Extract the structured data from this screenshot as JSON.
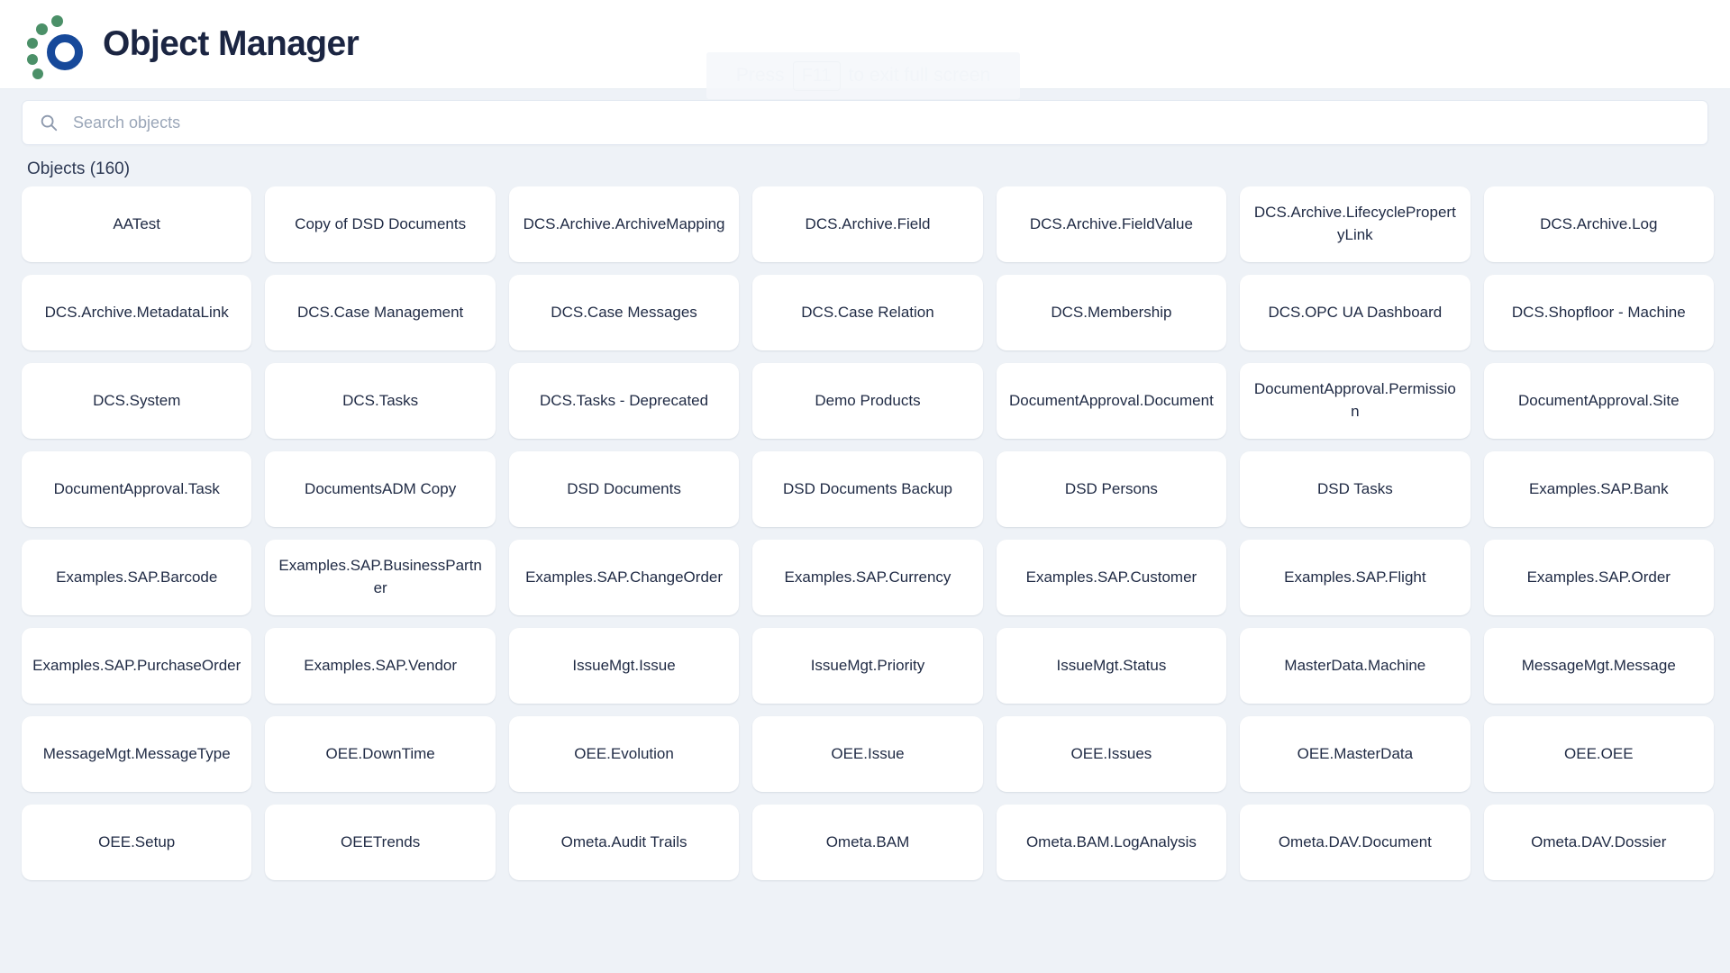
{
  "header": {
    "title": "Object Manager",
    "logo_icon": "ometa-logo-icon",
    "logo_colors": {
      "dots": "#4b9068",
      "ring": "#17499a"
    }
  },
  "fullscreen_toast": {
    "prefix": "Press",
    "key": "F11",
    "suffix": "to exit full screen"
  },
  "search": {
    "icon": "search-icon",
    "placeholder": "Search objects",
    "value": ""
  },
  "objects_section": {
    "label": "Objects (160)",
    "count": 160,
    "items": [
      "AATest",
      "Copy of DSD Documents",
      "DCS.Archive.ArchiveMapping",
      "DCS.Archive.Field",
      "DCS.Archive.FieldValue",
      "DCS.Archive.LifecyclePropertyLink",
      "DCS.Archive.Log",
      "DCS.Archive.MetadataLink",
      "DCS.Case Management",
      "DCS.Case Messages",
      "DCS.Case Relation",
      "DCS.Membership",
      "DCS.OPC UA Dashboard",
      "DCS.Shopfloor - Machine",
      "DCS.System",
      "DCS.Tasks",
      "DCS.Tasks - Deprecated",
      "Demo Products",
      "DocumentApproval.Document",
      "DocumentApproval.Permission",
      "DocumentApproval.Site",
      "DocumentApproval.Task",
      "DocumentsADM Copy",
      "DSD Documents",
      "DSD Documents Backup",
      "DSD Persons",
      "DSD Tasks",
      "Examples.SAP.Bank",
      "Examples.SAP.Barcode",
      "Examples.SAP.BusinessPartner",
      "Examples.SAP.ChangeOrder",
      "Examples.SAP.Currency",
      "Examples.SAP.Customer",
      "Examples.SAP.Flight",
      "Examples.SAP.Order",
      "Examples.SAP.PurchaseOrder",
      "Examples.SAP.Vendor",
      "IssueMgt.Issue",
      "IssueMgt.Priority",
      "IssueMgt.Status",
      "MasterData.Machine",
      "MessageMgt.Message",
      "MessageMgt.MessageType",
      "OEE.DownTime",
      "OEE.Evolution",
      "OEE.Issue",
      "OEE.Issues",
      "OEE.MasterData",
      "OEE.OEE",
      "OEE.Setup",
      "OEETrends",
      "Ometa.Audit Trails",
      "Ometa.BAM",
      "Ometa.BAM.LogAnalysis",
      "Ometa.DAV.Document",
      "Ometa.DAV.Dossier"
    ]
  },
  "scrollbar": {
    "name": "objects-scrollbar",
    "position": "right"
  }
}
